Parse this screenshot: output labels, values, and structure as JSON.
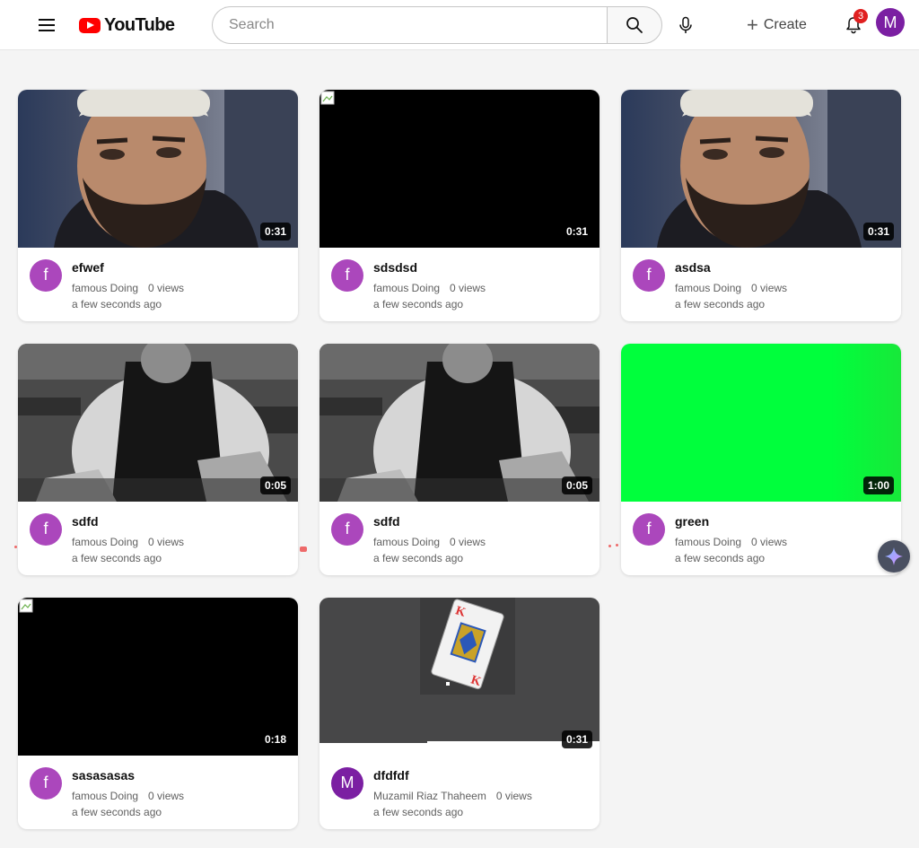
{
  "header": {
    "logo_text": "YouTube",
    "search_placeholder": "Search",
    "create_label": "Create",
    "notification_count": "3",
    "user_initial": "M"
  },
  "videos": [
    {
      "title": "efwef",
      "channel": "famous Doing",
      "views": "0 views",
      "age": "a few seconds ago",
      "duration": "0:31",
      "avatar": "f",
      "thumbnail": "man-portrait"
    },
    {
      "title": "sdsdsd",
      "channel": "famous Doing",
      "views": "0 views",
      "age": "a few seconds ago",
      "duration": "0:31",
      "avatar": "f",
      "thumbnail": "black"
    },
    {
      "title": "asdsa",
      "channel": "famous Doing",
      "views": "0 views",
      "age": "a few seconds ago",
      "duration": "0:31",
      "avatar": "f",
      "thumbnail": "man-portrait"
    },
    {
      "title": "sdfd",
      "channel": "famous Doing",
      "views": "0 views",
      "age": "a few seconds ago",
      "duration": "0:05",
      "avatar": "f",
      "thumbnail": "chef-bw"
    },
    {
      "title": "sdfd",
      "channel": "famous Doing",
      "views": "0 views",
      "age": "a few seconds ago",
      "duration": "0:05",
      "avatar": "f",
      "thumbnail": "chef-bw"
    },
    {
      "title": "green",
      "channel": "famous Doing",
      "views": "0 views",
      "age": "a few seconds ago",
      "duration": "1:00",
      "avatar": "f",
      "thumbnail": "green-screen"
    },
    {
      "title": "sasasasas",
      "channel": "famous Doing",
      "views": "0 views",
      "age": "a few seconds ago",
      "duration": "0:18",
      "avatar": "f",
      "thumbnail": "black"
    },
    {
      "title": "dfdfdf",
      "channel": "Muzamil Riaz Thaheem",
      "views": "0 views",
      "age": "a few seconds ago",
      "duration": "0:31",
      "avatar": "M",
      "thumbnail": "playing-card"
    }
  ],
  "colors": {
    "logo_red": "#ff0000",
    "avatar_purple": "#ab47bc",
    "user_avatar": "#7b1fa2",
    "green_screen": "#00ff3c",
    "badge_red": "#e02020"
  },
  "icons": [
    "menu-icon",
    "youtube-logo-icon",
    "search-icon",
    "mic-icon",
    "plus-icon",
    "bell-icon",
    "sparkle-icon",
    "broken-image-icon"
  ]
}
